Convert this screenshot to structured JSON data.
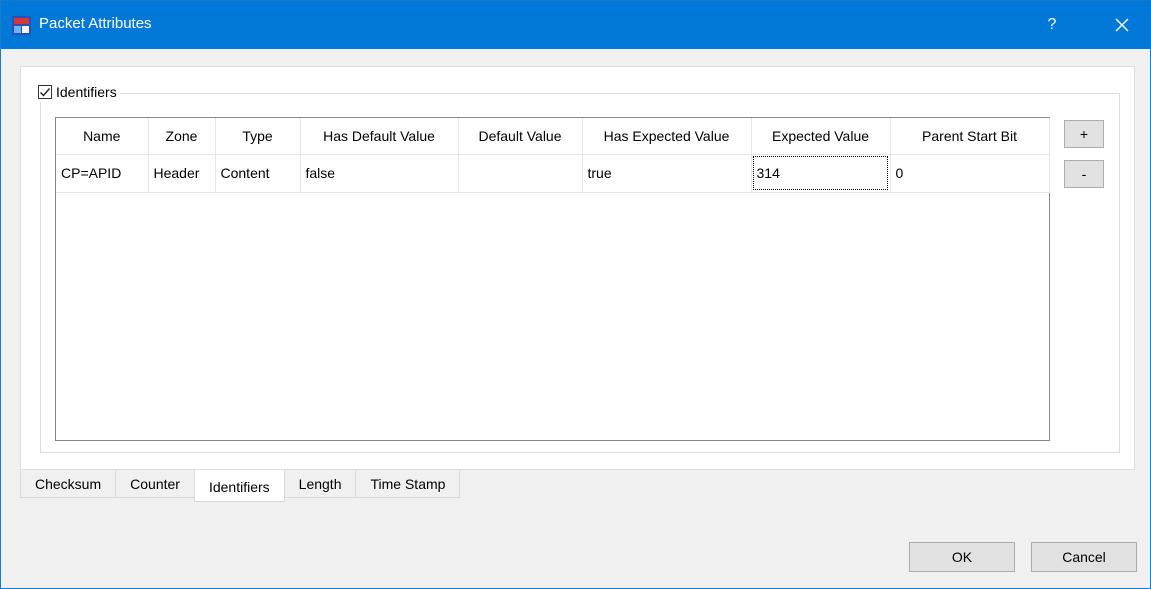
{
  "window": {
    "title": "Packet Attributes",
    "help_label": "?",
    "close_icon": "close-icon",
    "app_icon": "packet-app-icon",
    "accent_color": "#0078d7"
  },
  "group": {
    "label": "Identifiers",
    "checked": true
  },
  "table": {
    "columns": [
      "Name",
      "Zone",
      "Type",
      "Has Default Value",
      "Default Value",
      "Has Expected Value",
      "Expected Value",
      "Parent Start Bit"
    ],
    "rows": [
      [
        "CP=APID",
        "Header",
        "Content",
        "false",
        "",
        "true",
        "314",
        "0"
      ]
    ]
  },
  "side_buttons": {
    "add_label": "+",
    "remove_label": "-"
  },
  "tabs": [
    {
      "label": "Checksum",
      "active": false
    },
    {
      "label": "Counter",
      "active": false
    },
    {
      "label": "Identifiers",
      "active": true
    },
    {
      "label": "Length",
      "active": false
    },
    {
      "label": "Time Stamp",
      "active": false
    }
  ],
  "footer": {
    "ok_label": "OK",
    "cancel_label": "Cancel"
  }
}
